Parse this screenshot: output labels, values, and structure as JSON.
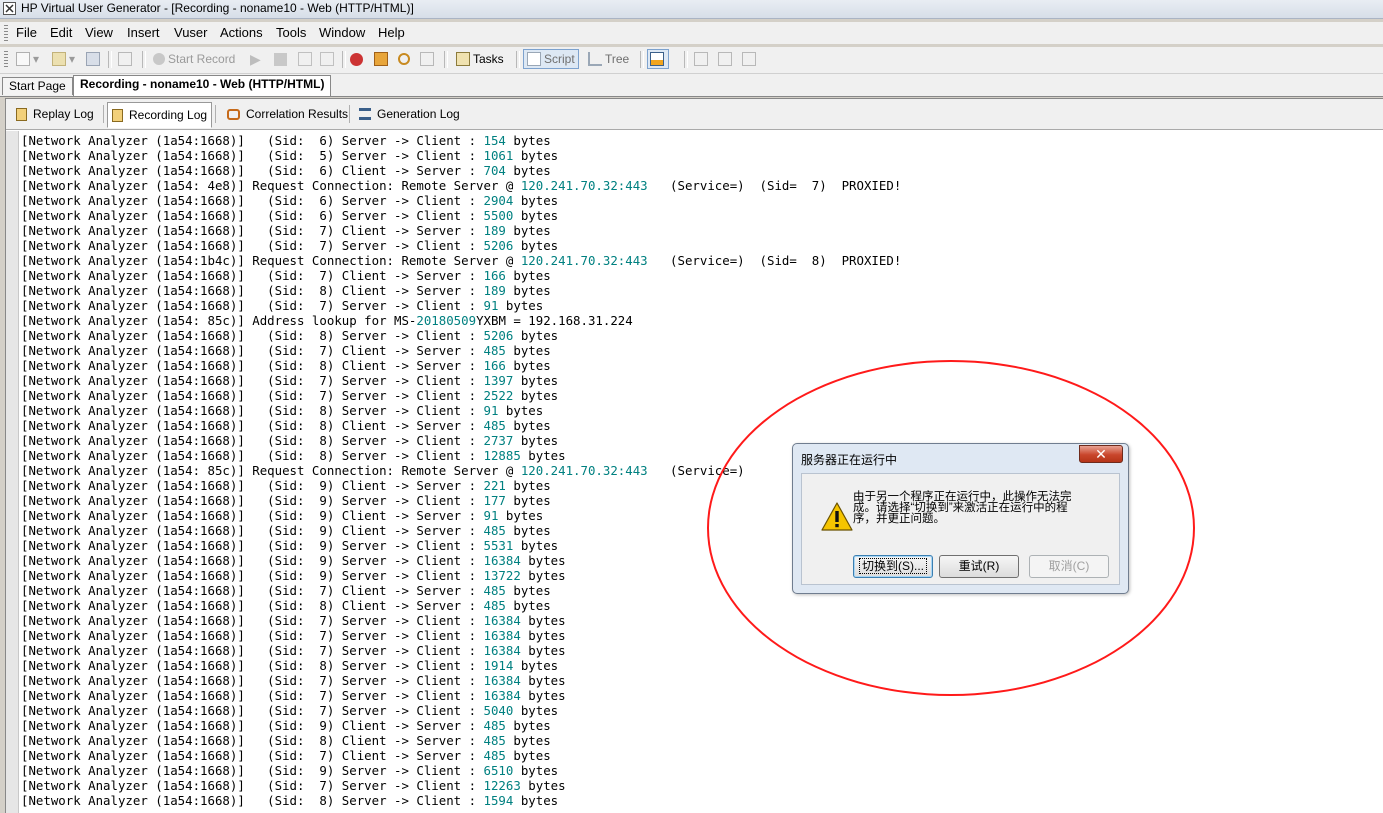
{
  "window": {
    "title": "HP Virtual User Generator - [Recording - noname10 - Web (HTTP/HTML)]"
  },
  "menu": [
    "File",
    "Edit",
    "View",
    "Insert",
    "Vuser",
    "Actions",
    "Tools",
    "Window",
    "Help"
  ],
  "toolbar": {
    "start_record": "Start Record",
    "tasks": "Tasks",
    "script": "Script",
    "tree": "Tree"
  },
  "doc_tabs": [
    "Start Page",
    "Recording - noname10 - Web (HTTP/HTML)"
  ],
  "output_tabs": [
    "Replay Log",
    "Recording Log",
    "Correlation Results",
    "Generation Log"
  ],
  "log_lines": [
    {
      "src": "[Network Analyzer (1a54:1668)]",
      "text": "   (Sid:  6) Server -> Client : ",
      "num": "154",
      "tail": " bytes"
    },
    {
      "src": "[Network Analyzer (1a54:1668)]",
      "text": "   (Sid:  5) Server -> Client : ",
      "num": "1061",
      "tail": " bytes"
    },
    {
      "src": "[Network Analyzer (1a54:1668)]",
      "text": "   (Sid:  6) Client -> Server : ",
      "num": "704",
      "tail": " bytes"
    },
    {
      "src": "[Network Analyzer (1a54: 4e8)]",
      "text": " Request Connection: Remote Server @ ",
      "num": "120.241.70.32:443",
      "tail": "   (Service=)  (Sid=  7)  PROXIED!"
    },
    {
      "src": "[Network Analyzer (1a54:1668)]",
      "text": "   (Sid:  6) Server -> Client : ",
      "num": "2904",
      "tail": " bytes"
    },
    {
      "src": "[Network Analyzer (1a54:1668)]",
      "text": "   (Sid:  6) Server -> Client : ",
      "num": "5500",
      "tail": " bytes"
    },
    {
      "src": "[Network Analyzer (1a54:1668)]",
      "text": "   (Sid:  7) Client -> Server : ",
      "num": "189",
      "tail": " bytes"
    },
    {
      "src": "[Network Analyzer (1a54:1668)]",
      "text": "   (Sid:  7) Server -> Client : ",
      "num": "5206",
      "tail": " bytes"
    },
    {
      "src": "[Network Analyzer (1a54:1b4c)]",
      "text": " Request Connection: Remote Server @ ",
      "num": "120.241.70.32:443",
      "tail": "   (Service=)  (Sid=  8)  PROXIED!"
    },
    {
      "src": "[Network Analyzer (1a54:1668)]",
      "text": "   (Sid:  7) Client -> Server : ",
      "num": "166",
      "tail": " bytes"
    },
    {
      "src": "[Network Analyzer (1a54:1668)]",
      "text": "   (Sid:  8) Client -> Server : ",
      "num": "189",
      "tail": " bytes"
    },
    {
      "src": "[Network Analyzer (1a54:1668)]",
      "text": "   (Sid:  7) Server -> Client : ",
      "num": "91",
      "tail": " bytes"
    },
    {
      "src": "[Network Analyzer (1a54: 85c)]",
      "text": " Address lookup for MS-",
      "num": "20180509",
      "tail": "YXBM = 192.168.31.224"
    },
    {
      "src": "[Network Analyzer (1a54:1668)]",
      "text": "   (Sid:  8) Server -> Client : ",
      "num": "5206",
      "tail": " bytes"
    },
    {
      "src": "[Network Analyzer (1a54:1668)]",
      "text": "   (Sid:  7) Client -> Server : ",
      "num": "485",
      "tail": " bytes"
    },
    {
      "src": "[Network Analyzer (1a54:1668)]",
      "text": "   (Sid:  8) Client -> Server : ",
      "num": "166",
      "tail": " bytes"
    },
    {
      "src": "[Network Analyzer (1a54:1668)]",
      "text": "   (Sid:  7) Server -> Client : ",
      "num": "1397",
      "tail": " bytes"
    },
    {
      "src": "[Network Analyzer (1a54:1668)]",
      "text": "   (Sid:  7) Server -> Client : ",
      "num": "2522",
      "tail": " bytes"
    },
    {
      "src": "[Network Analyzer (1a54:1668)]",
      "text": "   (Sid:  8) Server -> Client : ",
      "num": "91",
      "tail": " bytes"
    },
    {
      "src": "[Network Analyzer (1a54:1668)]",
      "text": "   (Sid:  8) Client -> Server : ",
      "num": "485",
      "tail": " bytes"
    },
    {
      "src": "[Network Analyzer (1a54:1668)]",
      "text": "   (Sid:  8) Server -> Client : ",
      "num": "2737",
      "tail": " bytes"
    },
    {
      "src": "[Network Analyzer (1a54:1668)]",
      "text": "   (Sid:  8) Server -> Client : ",
      "num": "12885",
      "tail": " bytes"
    },
    {
      "src": "[Network Analyzer (1a54: 85c)]",
      "text": " Request Connection: Remote Server @ ",
      "num": "120.241.70.32:443",
      "tail": "   (Service=)"
    },
    {
      "src": "[Network Analyzer (1a54:1668)]",
      "text": "   (Sid:  9) Client -> Server : ",
      "num": "221",
      "tail": " bytes"
    },
    {
      "src": "[Network Analyzer (1a54:1668)]",
      "text": "   (Sid:  9) Server -> Client : ",
      "num": "177",
      "tail": " bytes"
    },
    {
      "src": "[Network Analyzer (1a54:1668)]",
      "text": "   (Sid:  9) Client -> Server : ",
      "num": "91",
      "tail": " bytes"
    },
    {
      "src": "[Network Analyzer (1a54:1668)]",
      "text": "   (Sid:  9) Client -> Server : ",
      "num": "485",
      "tail": " bytes"
    },
    {
      "src": "[Network Analyzer (1a54:1668)]",
      "text": "   (Sid:  9) Server -> Client : ",
      "num": "5531",
      "tail": " bytes"
    },
    {
      "src": "[Network Analyzer (1a54:1668)]",
      "text": "   (Sid:  9) Server -> Client : ",
      "num": "16384",
      "tail": " bytes"
    },
    {
      "src": "[Network Analyzer (1a54:1668)]",
      "text": "   (Sid:  9) Server -> Client : ",
      "num": "13722",
      "tail": " bytes"
    },
    {
      "src": "[Network Analyzer (1a54:1668)]",
      "text": "   (Sid:  7) Client -> Server : ",
      "num": "485",
      "tail": " bytes"
    },
    {
      "src": "[Network Analyzer (1a54:1668)]",
      "text": "   (Sid:  8) Client -> Server : ",
      "num": "485",
      "tail": " bytes"
    },
    {
      "src": "[Network Analyzer (1a54:1668)]",
      "text": "   (Sid:  7) Server -> Client : ",
      "num": "16384",
      "tail": " bytes"
    },
    {
      "src": "[Network Analyzer (1a54:1668)]",
      "text": "   (Sid:  7) Server -> Client : ",
      "num": "16384",
      "tail": " bytes"
    },
    {
      "src": "[Network Analyzer (1a54:1668)]",
      "text": "   (Sid:  7) Server -> Client : ",
      "num": "16384",
      "tail": " bytes"
    },
    {
      "src": "[Network Analyzer (1a54:1668)]",
      "text": "   (Sid:  8) Server -> Client : ",
      "num": "1914",
      "tail": " bytes"
    },
    {
      "src": "[Network Analyzer (1a54:1668)]",
      "text": "   (Sid:  7) Server -> Client : ",
      "num": "16384",
      "tail": " bytes"
    },
    {
      "src": "[Network Analyzer (1a54:1668)]",
      "text": "   (Sid:  7) Server -> Client : ",
      "num": "16384",
      "tail": " bytes"
    },
    {
      "src": "[Network Analyzer (1a54:1668)]",
      "text": "   (Sid:  7) Server -> Client : ",
      "num": "5040",
      "tail": " bytes"
    },
    {
      "src": "[Network Analyzer (1a54:1668)]",
      "text": "   (Sid:  9) Client -> Server : ",
      "num": "485",
      "tail": " bytes"
    },
    {
      "src": "[Network Analyzer (1a54:1668)]",
      "text": "   (Sid:  8) Client -> Server : ",
      "num": "485",
      "tail": " bytes"
    },
    {
      "src": "[Network Analyzer (1a54:1668)]",
      "text": "   (Sid:  7) Client -> Server : ",
      "num": "485",
      "tail": " bytes"
    },
    {
      "src": "[Network Analyzer (1a54:1668)]",
      "text": "   (Sid:  9) Server -> Client : ",
      "num": "6510",
      "tail": " bytes"
    },
    {
      "src": "[Network Analyzer (1a54:1668)]",
      "text": "   (Sid:  7) Server -> Client : ",
      "num": "12263",
      "tail": " bytes"
    },
    {
      "src": "[Network Analyzer (1a54:1668)]",
      "text": "   (Sid:  8) Server -> Client : ",
      "num": "1594",
      "tail": " bytes"
    }
  ],
  "dialog": {
    "title": "服务器正在运行中",
    "close": "✕",
    "message_lines": [
      "由于另一个程序正在运行中，此操作无法完",
      "成。请选择“切换到”来激活正在运行中的程",
      "序，并更正问题。"
    ],
    "switch_button": "切换到(S)...",
    "retry_button": "重试(R)",
    "cancel_button": "取消(C)"
  },
  "annotation": {
    "circle_color": "#ff1a1a"
  },
  "colors": {
    "log_number": "#008080",
    "dialog_frame": "#dfe8f3",
    "close_button": "#c9462c"
  }
}
